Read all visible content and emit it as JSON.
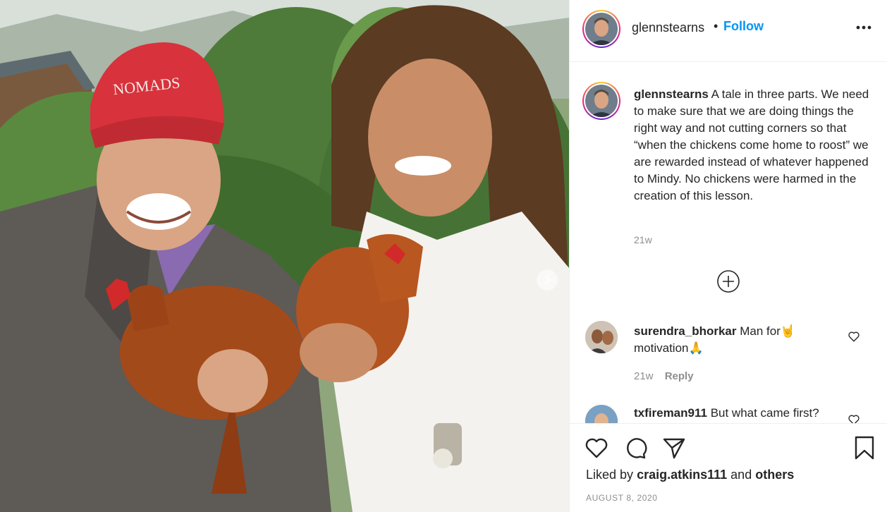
{
  "post": {
    "username": "glennstearns",
    "dot": "•",
    "follow_label": "Follow",
    "more_label": "•••"
  },
  "caption": {
    "username": "glennstearns",
    "text": "A tale in three parts. We need to make sure that we are doing things the right way and not cutting corners so that “when the chickens come home to roost” we are rewarded instead of whatever happened to Mindy. No chickens were harmed in the creation of this lesson.",
    "time": "21w"
  },
  "comments": [
    {
      "username": "surendra_bhorkar",
      "text": "Man for🤘 motivation🙏",
      "time": "21w",
      "reply_label": "Reply"
    },
    {
      "username": "txfireman911",
      "text": "But what came first?"
    }
  ],
  "photo": {
    "cap_text": "NOMADS"
  },
  "footer": {
    "liked_prefix": "Liked by",
    "liked_user": "craig.atkins111",
    "liked_and": "and",
    "liked_others": "others",
    "date": "AUGUST 8, 2020"
  },
  "colors": {
    "link_blue": "#0095f6",
    "text": "#262626",
    "muted": "#8e8e8e"
  },
  "icons": [
    "heart-icon",
    "comment-icon",
    "share-icon",
    "bookmark-icon",
    "more-icon",
    "plus-circle-icon",
    "chevron-right-icon"
  ]
}
